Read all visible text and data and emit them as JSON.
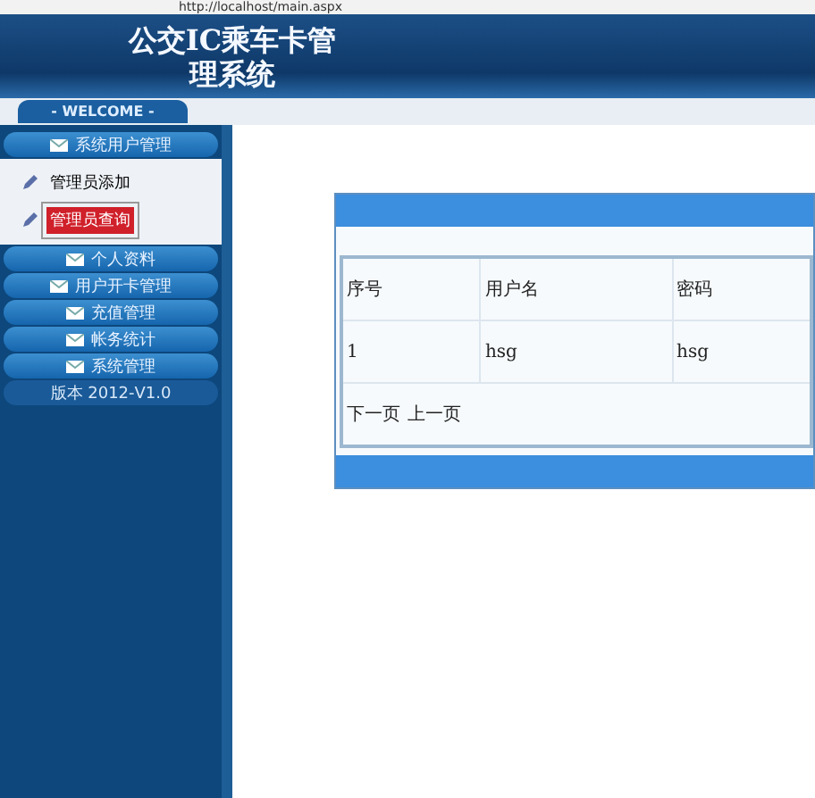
{
  "address_bar": {
    "url": "http://localhost/main.aspx"
  },
  "header": {
    "title": "公交IC乘车卡管理系统"
  },
  "welcome": "- WELCOME -",
  "sidebar": {
    "groups": [
      {
        "label": "系统用户管理",
        "children": [
          {
            "label": "管理员添加",
            "selected": false
          },
          {
            "label": "管理员查询",
            "selected": true
          }
        ]
      },
      {
        "label": "个人资料"
      },
      {
        "label": "用户开卡管理"
      },
      {
        "label": "充值管理"
      },
      {
        "label": "帐务统计"
      },
      {
        "label": "系统管理"
      }
    ],
    "version": "版本 2012-V1.0"
  },
  "table": {
    "columns": [
      "序号",
      "用户名",
      "密码"
    ],
    "rows": [
      [
        "1",
        "hsg",
        "hsg"
      ]
    ],
    "pager": [
      "下一页",
      "上一页"
    ]
  }
}
